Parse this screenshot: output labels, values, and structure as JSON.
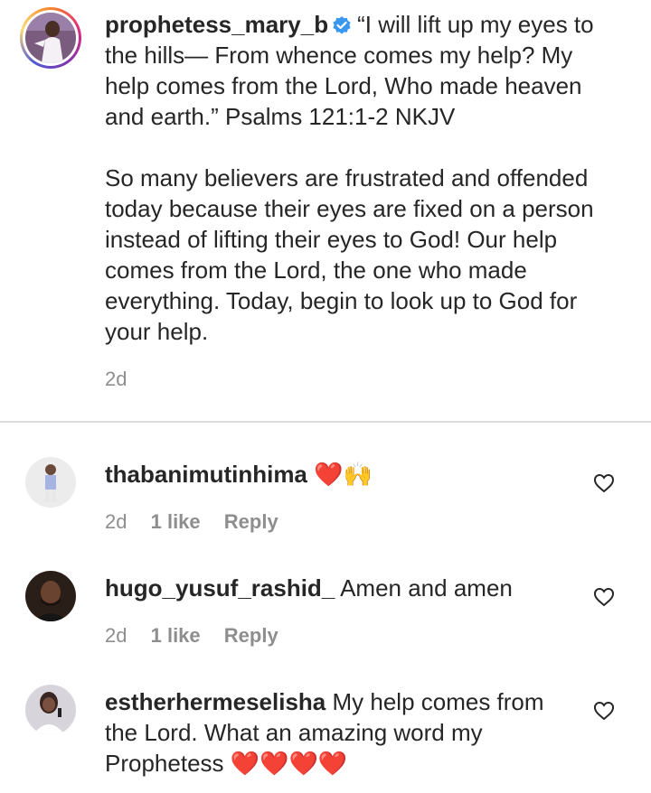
{
  "post": {
    "username": "prophetess_mary_b",
    "caption": "“I will lift up my eyes to the hills— From whence comes my help? My help comes from the Lord, Who made heaven and earth.” Psalms 121:1-2 NKJV\n\nSo many believers are frustrated and offended today because their eyes are fixed on a person instead of lifting their eyes to God! Our help comes from the Lord, the one who made everything. Today, begin to look up to God for your help.",
    "age": "2d",
    "verified_icon": "verified-badge-icon"
  },
  "comments": [
    {
      "username": "thabanimutinhima",
      "text": "",
      "emoji": "❤️🙌",
      "age": "2d",
      "likes": "1 like",
      "reply": "Reply"
    },
    {
      "username": "hugo_yusuf_rashid_",
      "text": "Amen and amen",
      "emoji": "",
      "age": "2d",
      "likes": "1 like",
      "reply": "Reply"
    },
    {
      "username": "estherhermeselisha",
      "text": "My help comes from the Lord. What an amazing word my Prophetess",
      "emoji": "❤️❤️❤️❤️",
      "age": "",
      "likes": "",
      "reply": ""
    }
  ],
  "colors": {
    "text": "#262626",
    "muted": "#8e8e8e",
    "verified": "#3897f0",
    "heart_emoji": "#e0245e"
  }
}
